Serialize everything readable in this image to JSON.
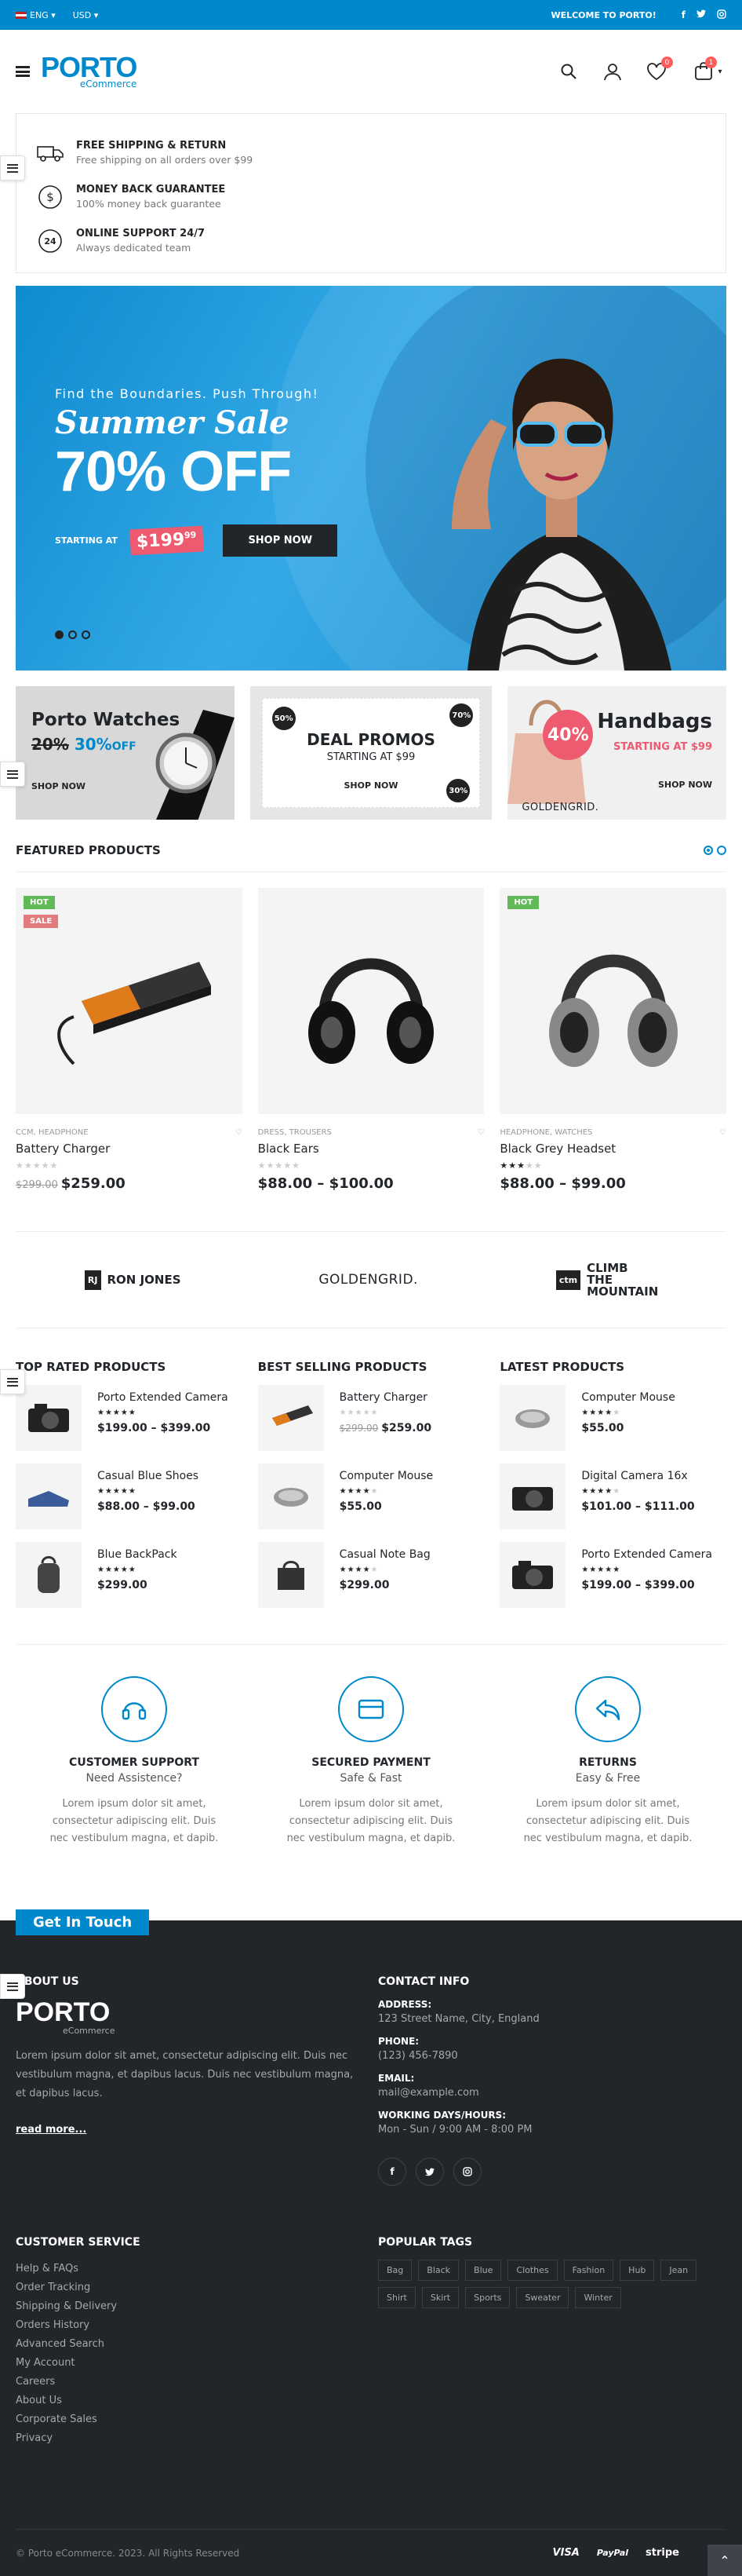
{
  "topbar": {
    "language": "ENG",
    "currency": "USD",
    "welcome": "WELCOME TO PORTO!",
    "social": [
      "f",
      "t",
      "ig"
    ]
  },
  "header": {
    "logo": "PORTO",
    "logo_sub": "eCommerce",
    "wishlist_count": "0",
    "cart_count": "1"
  },
  "infobox": [
    {
      "title": "FREE SHIPPING & RETURN",
      "text": "Free shipping on all orders over $99",
      "icon": "truck-icon"
    },
    {
      "title": "MONEY BACK GUARANTEE",
      "text": "100% money back guarantee",
      "icon": "dollar-icon"
    },
    {
      "title": "ONLINE SUPPORT 24/7",
      "text": "Always dedicated team",
      "icon": "support-24-icon"
    }
  ],
  "hero": {
    "tagline": "Find the Boundaries. Push Through!",
    "title": "Summer Sale",
    "discount": "70% OFF",
    "starting_at": "STARTING AT",
    "price": "$199",
    "price_cents": "99",
    "button": "SHOP NOW"
  },
  "banners": {
    "watches": {
      "title": "Porto Watches",
      "old": "20%",
      "new": "30%",
      "off": "OFF",
      "shop": "SHOP NOW"
    },
    "deals": {
      "title": "DEAL PROMOS",
      "sub": "STARTING AT $99",
      "shop": "SHOP NOW",
      "c1": "50%",
      "c2": "70%",
      "c3": "30%"
    },
    "handbags": {
      "title": "Handbags",
      "sub": "STARTING AT $99",
      "shop": "SHOP NOW",
      "pct": "40%",
      "brand": "GOLDENGRID."
    }
  },
  "featured": {
    "title": "FEATURED PRODUCTS",
    "products": [
      {
        "cat": "CCM, HEADPHONE",
        "name": "Battery Charger",
        "old": "$299.00",
        "price": "$259.00",
        "hot": "HOT",
        "sale": "SALE",
        "rating": 0
      },
      {
        "cat": "DRESS, TROUSERS",
        "name": "Black Ears",
        "price": "$88.00 – $100.00",
        "rating": 0
      },
      {
        "cat": "HEADPHONE, WATCHES",
        "name": "Black Grey Headset",
        "price": "$88.00 – $99.00",
        "hot": "HOT",
        "rating": 3
      }
    ]
  },
  "brands": [
    "RON JONES",
    "GOLDENGRID.",
    "CLIMB THE MOUNTAIN"
  ],
  "lists": [
    {
      "title": "TOP RATED PRODUCTS",
      "items": [
        {
          "name": "Porto Extended Camera",
          "price": "$199.00 – $399.00"
        },
        {
          "name": "Casual Blue Shoes",
          "price": "$88.00 – $99.00"
        },
        {
          "name": "Blue BackPack",
          "price": "$299.00"
        }
      ]
    },
    {
      "title": "BEST SELLING PRODUCTS",
      "items": [
        {
          "name": "Battery Charger",
          "old": "$299.00",
          "price": "$259.00"
        },
        {
          "name": "Computer Mouse",
          "price": "$55.00"
        },
        {
          "name": "Casual Note Bag",
          "price": "$299.00"
        }
      ]
    },
    {
      "title": "LATEST PRODUCTS",
      "items": [
        {
          "name": "Computer Mouse",
          "price": "$55.00"
        },
        {
          "name": "Digital Camera 16x",
          "price": "$101.00 – $111.00"
        },
        {
          "name": "Porto Extended Camera",
          "price": "$199.00 – $399.00"
        }
      ]
    }
  ],
  "features": [
    {
      "title": "CUSTOMER SUPPORT",
      "sub": "Need Assistence?",
      "text": "Lorem ipsum dolor sit amet, consectetur adipiscing elit. Duis nec vestibulum magna, et dapib."
    },
    {
      "title": "SECURED PAYMENT",
      "sub": "Safe & Fast",
      "text": "Lorem ipsum dolor sit amet, consectetur adipiscing elit. Duis nec vestibulum magna, et dapib."
    },
    {
      "title": "RETURNS",
      "sub": "Easy & Free",
      "text": "Lorem ipsum dolor sit amet, consectetur adipiscing elit. Duis nec vestibulum magna, et dapib."
    }
  ],
  "get_in_touch": "Get In Touch",
  "footer": {
    "about_title": "ABOUT US",
    "about_text": "Lorem ipsum dolor sit amet, consectetur adipiscing elit. Duis nec vestibulum magna, et dapibus lacus. Duis nec vestibulum magna, et dapibus lacus.",
    "read_more": "read more...",
    "contact_title": "CONTACT INFO",
    "address_label": "ADDRESS:",
    "address": "123 Street Name, City, England",
    "phone_label": "PHONE:",
    "phone": "(123) 456-7890",
    "email_label": "EMAIL:",
    "email": "mail@example.com",
    "hours_label": "WORKING DAYS/HOURS:",
    "hours": "Mon - Sun / 9:00 AM - 8:00 PM",
    "service_title": "CUSTOMER SERVICE",
    "service_links": [
      "Help & FAQs",
      "Order Tracking",
      "Shipping & Delivery",
      "Orders History",
      "Advanced Search",
      "My Account",
      "Careers",
      "About Us",
      "Corporate Sales",
      "Privacy"
    ],
    "tags_title": "POPULAR TAGS",
    "tags": [
      "Bag",
      "Black",
      "Blue",
      "Clothes",
      "Fashion",
      "Hub",
      "Jean",
      "Shirt",
      "Skirt",
      "Sports",
      "Sweater",
      "Winter"
    ],
    "copyright": "© Porto eCommerce. 2023. All Rights Reserved",
    "payments": [
      "VISA",
      "PayPal",
      "stripe"
    ]
  },
  "colors": {
    "primary": "#0088cc",
    "dark": "#222529",
    "sale": "#ee5a6f",
    "hot": "#62b959"
  }
}
